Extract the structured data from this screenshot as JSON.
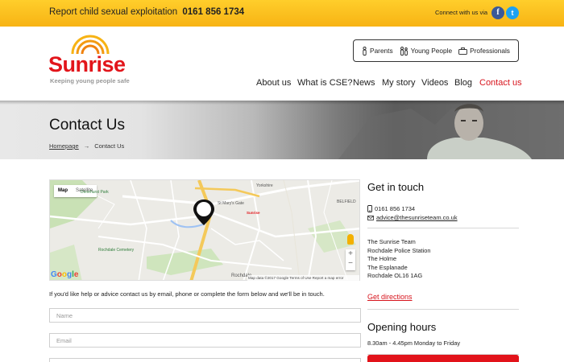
{
  "topbar": {
    "report_text": "Report child sexual exploitation",
    "report_phone": "0161 856 1734",
    "connect_text": "Connect with us via",
    "facebook_glyph": "f",
    "twitter_glyph": "t"
  },
  "logo": {
    "name": "Sunrise",
    "tagline": "Keeping young people safe"
  },
  "audience": {
    "items": [
      {
        "label": "Parents",
        "icon": "parents-icon"
      },
      {
        "label": "Young People",
        "icon": "young-people-icon"
      },
      {
        "label": "Professionals",
        "icon": "briefcase-icon"
      }
    ]
  },
  "nav": {
    "items": [
      {
        "label": "About us"
      },
      {
        "label": "What is CSE?"
      },
      {
        "label": "News"
      },
      {
        "label": "My story"
      },
      {
        "label": "Videos"
      },
      {
        "label": "Blog"
      },
      {
        "label": "Contact us",
        "active": true
      }
    ]
  },
  "banner": {
    "title": "Contact Us",
    "breadcrumb_home": "Homepage",
    "breadcrumb_arrow": "→",
    "breadcrumb_current": "Contact Us"
  },
  "map": {
    "type_map": "Map",
    "type_satellite": "Satellite",
    "marker_label": "Sunrise",
    "labels": {
      "park": "Denehurst Park",
      "cemetery": "Rochdale Cemetery",
      "rochdale": "Rochdale",
      "belfield": "BELFIELD",
      "marys_gate": "St Mary's Gate",
      "yorkshire": "Yorkshire"
    },
    "google": [
      "G",
      "o",
      "o",
      "g",
      "l",
      "e"
    ],
    "footer": "Map data ©2017 Google    Terms of Use    Report a map error",
    "zoom_in": "+",
    "zoom_out": "−"
  },
  "form": {
    "intro": "If you'd like help or advice contact us by email, phone or complete the form below and we'll be in touch.",
    "name_placeholder": "Name",
    "email_placeholder": "Email"
  },
  "contact": {
    "heading": "Get in touch",
    "phone": "0161 856 1734",
    "email": "advice@thesunriseteam.co.uk",
    "address": [
      "The Sunrise Team",
      "Rochdale Police Station",
      "The Holme",
      "The Esplanade",
      "Rochdale OL16 1AG"
    ],
    "directions": "Get directions",
    "hours_heading": "Opening hours",
    "hours": "8.30am - 4.45pm Monday to Friday"
  },
  "colors": {
    "brand_red": "#e2151b",
    "topbar_yellow": "#ffce2b"
  }
}
